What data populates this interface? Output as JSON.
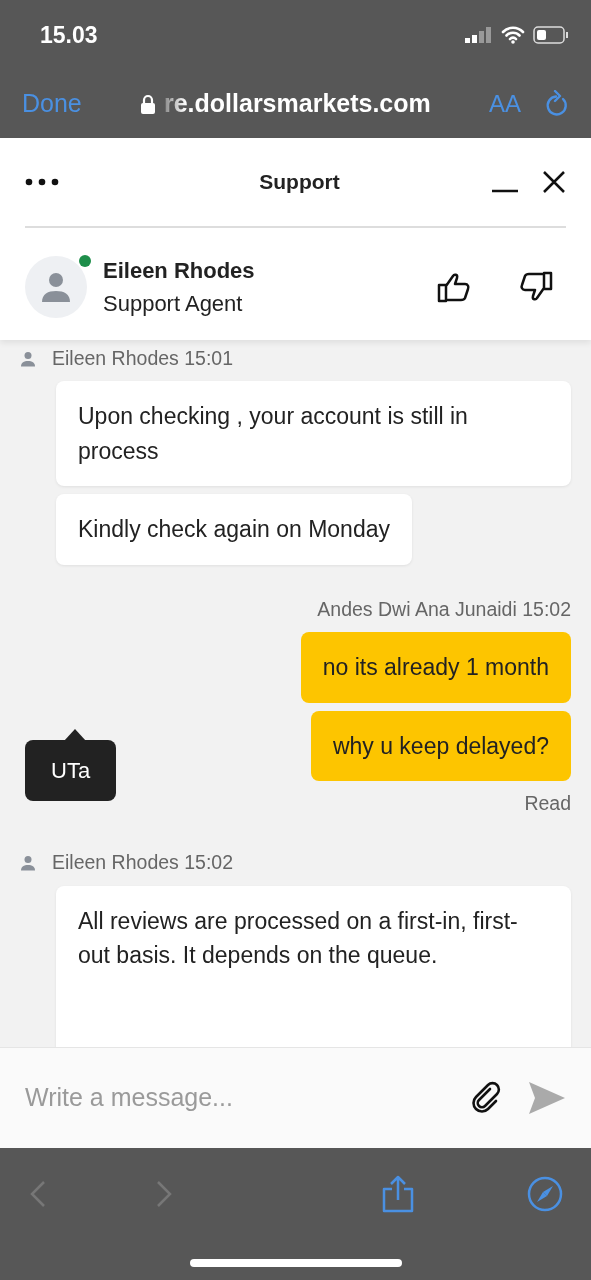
{
  "status_bar": {
    "time": "15.03"
  },
  "browser_bar": {
    "done": "Done",
    "url": "re.dollarsmarkets.com",
    "text_size": "AA"
  },
  "chat_header": {
    "title": "Support",
    "agent": {
      "name": "Eileen Rhodes",
      "role": "Support Agent",
      "online": true
    }
  },
  "messages": [
    {
      "kind": "agent",
      "meta": "Eileen Rhodes 15:01",
      "bubbles": [
        "Upon checking , your account is still in process",
        "Kindly check again on Monday"
      ]
    },
    {
      "kind": "user",
      "meta": "Andes Dwi Ana Junaidi 15:02",
      "bubbles": [
        "no its already 1 month",
        "why u keep delayed?"
      ],
      "receipt": "Read"
    },
    {
      "kind": "agent",
      "meta": "Eileen Rhodes 15:02",
      "bubbles": [
        "All reviews are processed on a first-in, first-out basis. It depends on the queue."
      ]
    }
  ],
  "tooltip": "UTa",
  "composer": {
    "placeholder": "Write a message..."
  }
}
